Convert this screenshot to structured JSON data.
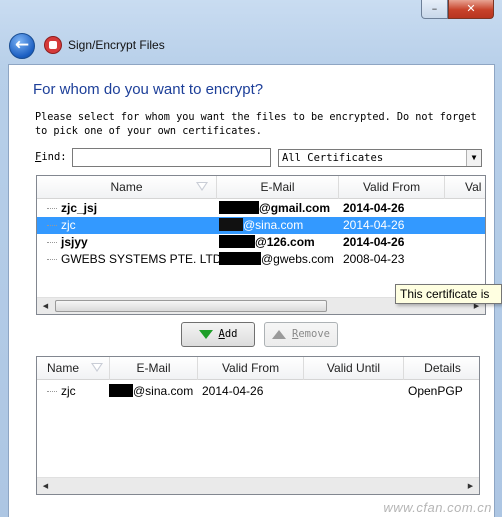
{
  "window": {
    "title": "Sign/Encrypt Files",
    "minimize_glyph": "–",
    "close_glyph": "✕"
  },
  "icons": {
    "back": "back-arrow-icon",
    "app": "kleopatra-app-icon",
    "back_glyph": "←"
  },
  "page": {
    "heading": "For whom do you want to encrypt?",
    "instruction": "Please select for whom you want the files to be encrypted. Do not forget to pick one of your own certificates."
  },
  "find": {
    "label_hotkey": "F",
    "label_rest": "ind:",
    "value": ""
  },
  "filter": {
    "selected": "All Certificates"
  },
  "available": {
    "columns": [
      "Name",
      "E-Mail",
      "Valid From",
      "Val"
    ],
    "rows": [
      {
        "name": "zjc_jsj",
        "email": "@gmail.com",
        "valid_from": "2014-04-26",
        "bold": true,
        "selected": false
      },
      {
        "name": "zjc",
        "email": "@sina.com",
        "valid_from": "2014-04-26",
        "bold": false,
        "selected": true
      },
      {
        "name": "jsjyy",
        "email": "@126.com",
        "valid_from": "2014-04-26",
        "bold": true,
        "selected": false
      },
      {
        "name": "GWEBS SYSTEMS PTE. LTD",
        "email": "@gwebs.com",
        "valid_from": "2008-04-23",
        "bold": false,
        "selected": false
      }
    ]
  },
  "tooltip": {
    "text": "This certificate is"
  },
  "buttons": {
    "add_hotkey": "A",
    "add_rest": "dd",
    "remove_hotkey": "R",
    "remove_rest": "emove"
  },
  "selected_list": {
    "columns": [
      "Name",
      "E-Mail",
      "Valid From",
      "Valid Until",
      "Details"
    ],
    "rows": [
      {
        "name": "zjc",
        "email": "@sina.com",
        "valid_from": "2014-04-26",
        "valid_until": "",
        "details": "OpenPGP"
      }
    ]
  },
  "scroll": {
    "left_glyph": "◀",
    "right_glyph": "▶",
    "dropdown_glyph": "▼"
  },
  "watermark": {
    "text": "www.cfan.com.cn"
  },
  "colors": {
    "selection": "#3399ff",
    "heading": "#1d3f99",
    "add_arrow": "#1d9e28"
  }
}
